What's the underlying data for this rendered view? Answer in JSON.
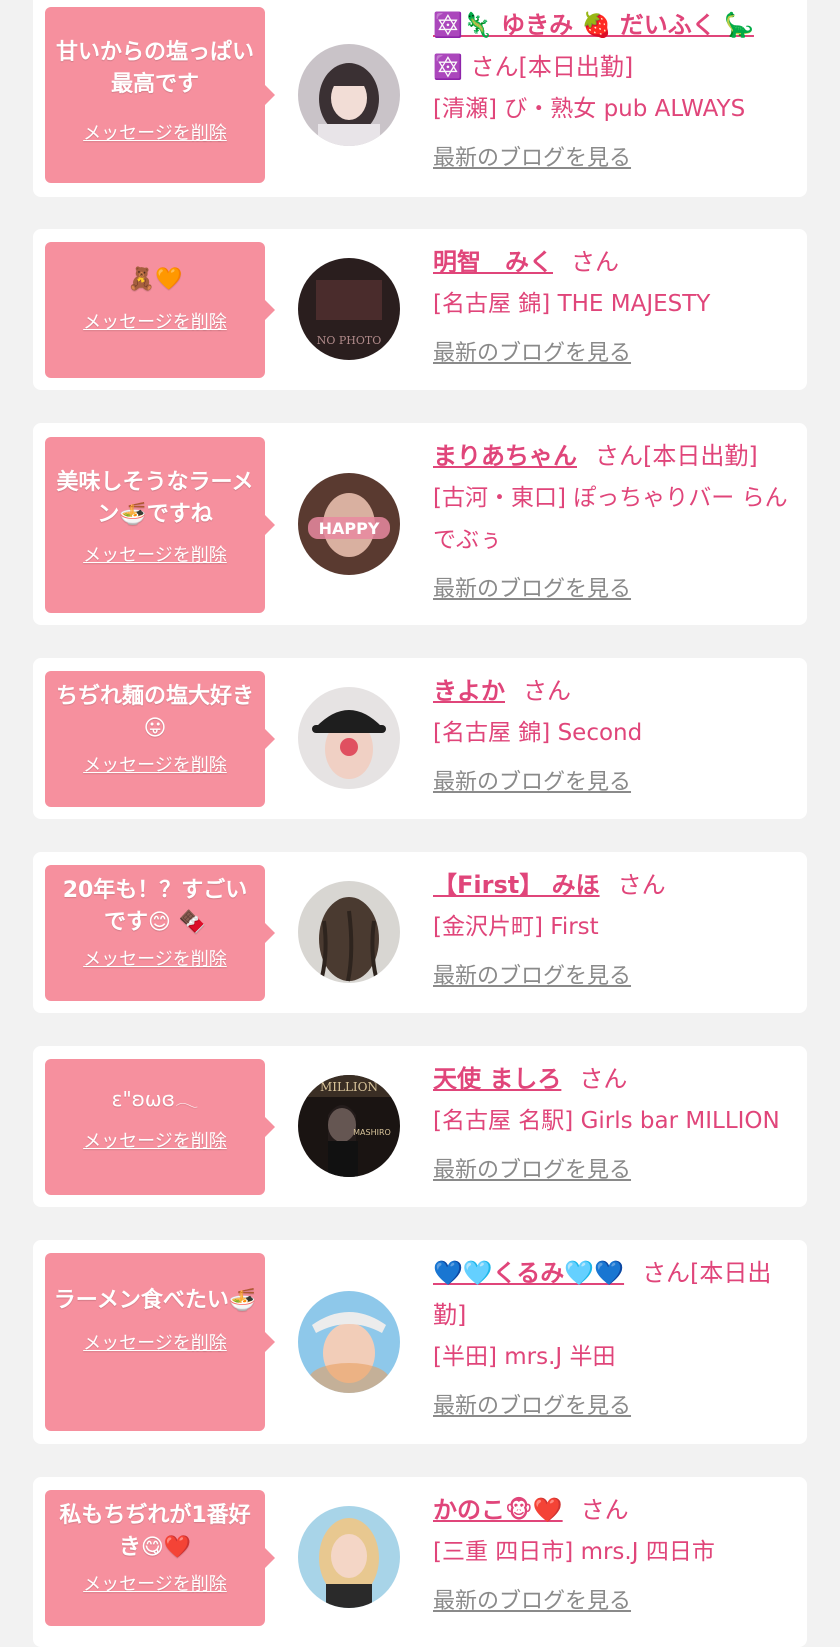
{
  "delete_label": "メッセージを削除",
  "blog_label": "最新のブログを見る",
  "san_suffix": "さん",
  "colors": {
    "page_bg": "#f2f2f2",
    "card_bg": "#ffffff",
    "bubble_bg": "#f6909e",
    "accent_pink": "#e0457a",
    "link_gray": "#8a8a8a"
  },
  "cards": [
    {
      "message": "甘いからの塩っぱい最高です",
      "name": "🔯🦎 ゆきみ 🍓 だいふく 🦕",
      "name_suffix": "🔯 さん[本日出勤]",
      "shop": "[清瀬] び・熟女 pub ALWAYS",
      "avatar_icon": "girl-photo-avatar"
    },
    {
      "message": "🧸🧡",
      "name": "明智　みく",
      "name_suffix": "さん",
      "shop": "[名古屋 錦] THE MAJESTY",
      "avatar_icon": "no-photo-avatar"
    },
    {
      "message": "美味しそうなラーメン🍜ですね",
      "name": "まりあちゃん",
      "name_suffix": "さん[本日出勤]",
      "shop": "[古河・東口] ぽっちゃりバー らんでぶぅ",
      "avatar_icon": "happy-photo-avatar"
    },
    {
      "message": "ちぢれ麺の塩大好き😛",
      "name": "きよか",
      "name_suffix": "さん",
      "shop": "[名古屋 錦] Second",
      "avatar_icon": "cap-girl-avatar"
    },
    {
      "message": "20年も！？すごいです😊 🍫",
      "name": "【First】 みほ",
      "name_suffix": "さん",
      "shop": "[金沢片町] First",
      "avatar_icon": "hair-back-avatar"
    },
    {
      "message": "ε\"ʚωɞ𓂃",
      "name": "天使 ましろ",
      "name_suffix": "さん",
      "shop": "[名古屋 名駅] Girls bar MILLION",
      "avatar_icon": "million-poster-avatar"
    },
    {
      "message": "ラーメン食べたい🍜",
      "name": "💙🩵くるみ🩵💙",
      "name_suffix": "さん[本日出勤]",
      "shop": "[半田] mrs.J 半田",
      "avatar_icon": "visor-girl-avatar"
    },
    {
      "message": "私もちぢれが1番好き😋❤️",
      "name": "かのこ🐵❤️",
      "name_suffix": "さん",
      "shop": "[三重 四日市] mrs.J 四日市",
      "avatar_icon": "blonde-girl-avatar"
    }
  ]
}
